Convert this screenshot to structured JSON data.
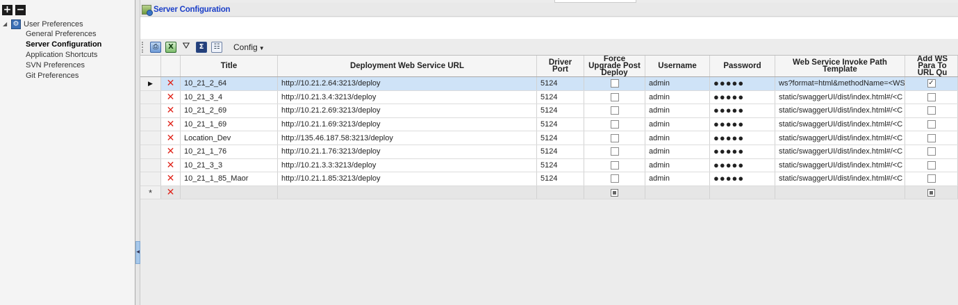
{
  "tree": {
    "tools": {
      "expand": "+",
      "collapse": "−"
    },
    "root_label": "User Preferences",
    "children": [
      "General Preferences",
      "Server Configuration",
      "Application Shortcuts",
      "SVN Preferences",
      "Git Preferences"
    ],
    "selected_index": 1
  },
  "header": {
    "title": "Server Configuration"
  },
  "toolbar": {
    "excel_icon_glyph": "X",
    "sum_icon_glyph": "Σ",
    "config_label": "Config"
  },
  "grid": {
    "columns": {
      "title": "Title",
      "url": "Deployment Web Service URL",
      "port": "Driver Port",
      "force": "Force Upgrade Post Deploy",
      "user": "Username",
      "pass": "Password",
      "path": "Web Service Invoke Path Template",
      "add": "Add WS Para To URL Qu"
    },
    "rows": [
      {
        "title": "10_21_2_64",
        "url": "http://10.21.2.64:3213/deploy",
        "port": "5124",
        "force": false,
        "user": "admin",
        "pass": "●●●●●",
        "path": "ws?format=html&methodName=<WS",
        "add": true,
        "selected": true
      },
      {
        "title": "10_21_3_4",
        "url": "http://10.21.3.4:3213/deploy",
        "port": "5124",
        "force": false,
        "user": "admin",
        "pass": "●●●●●",
        "path": "static/swaggerUI/dist/index.html#/<C",
        "add": false
      },
      {
        "title": "10_21_2_69",
        "url": "http://10.21.2.69:3213/deploy",
        "port": "5124",
        "force": false,
        "user": "admin",
        "pass": "●●●●●",
        "path": "static/swaggerUI/dist/index.html#/<C",
        "add": false
      },
      {
        "title": "10_21_1_69",
        "url": "http://10.21.1.69:3213/deploy",
        "port": "5124",
        "force": false,
        "user": "admin",
        "pass": "●●●●●",
        "path": "static/swaggerUI/dist/index.html#/<C",
        "add": false
      },
      {
        "title": "Location_Dev",
        "url": "http://135.46.187.58:3213/deploy",
        "port": "5124",
        "force": false,
        "user": "admin",
        "pass": "●●●●●",
        "path": "static/swaggerUI/dist/index.html#/<C",
        "add": false
      },
      {
        "title": "10_21_1_76",
        "url": "http://10.21.1.76:3213/deploy",
        "port": "5124",
        "force": false,
        "user": "admin",
        "pass": "●●●●●",
        "path": "static/swaggerUI/dist/index.html#/<C",
        "add": false
      },
      {
        "title": "10_21_3_3",
        "url": "http://10.21.3.3:3213/deploy",
        "port": "5124",
        "force": false,
        "user": "admin",
        "pass": "●●●●●",
        "path": "static/swaggerUI/dist/index.html#/<C",
        "add": false
      },
      {
        "title": "10_21_1_85_Maor",
        "url": "http://10.21.1.85:3213/deploy",
        "port": "5124",
        "force": false,
        "user": "admin",
        "pass": "●●●●●",
        "path": "static/swaggerUI/dist/index.html#/<C",
        "add": false
      }
    ],
    "new_row_indicator": "*",
    "current_row_indicator": "▶",
    "delete_glyph": "✕",
    "check_glyph": "✓"
  },
  "colors": {
    "header_title": "#1a3ec8",
    "selected_row": "#cfe3f7",
    "delete_icon": "#e0251b"
  }
}
